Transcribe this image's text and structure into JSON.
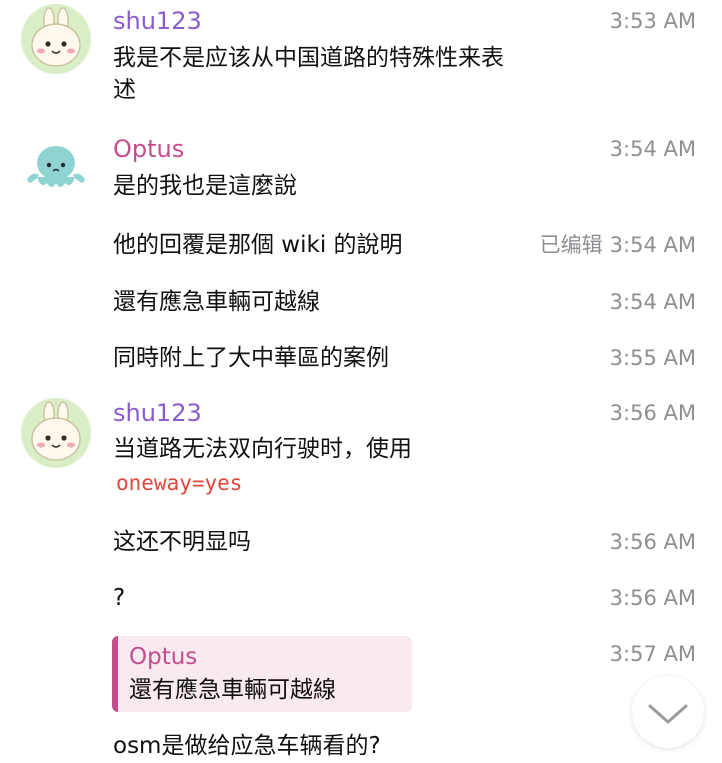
{
  "messages": [
    {
      "sender": "shu123",
      "text_lines": [
        "我是不是应该从中国道路的特殊性来表",
        "述"
      ],
      "time": "3:53 AM"
    },
    {
      "sender": "Optus",
      "text": "是的我也是這麼說",
      "time": "3:54 AM"
    },
    {
      "text": "他的回覆是那個 wiki 的說明",
      "edited": "已编辑",
      "time": "3:54 AM"
    },
    {
      "text": "還有應急車輛可越線",
      "time": "3:54 AM"
    },
    {
      "text": "同時附上了大中華區的案例",
      "time": "3:55 AM"
    },
    {
      "sender": "shu123",
      "text": "当道路无法双向行驶时，使用",
      "code": "oneway=yes",
      "time": "3:56 AM"
    },
    {
      "text": "这还不明显吗",
      "time": "3:56 AM"
    },
    {
      "text": "?",
      "time": "3:56 AM"
    },
    {
      "reply_to": {
        "sender": "Optus",
        "text": "還有應急車輛可越線"
      },
      "time": "3:57 AM",
      "text": "osm是做给应急车辆看的?"
    }
  ],
  "colors": {
    "shu123_name": "#8a5cd0",
    "optus_name": "#c54d8b",
    "code": "#e0463a",
    "time": "#8e8e93",
    "quote_bg": "#f9eaf1"
  },
  "icons": {
    "shu123_avatar": "bunny-avatar-icon",
    "optus_avatar": "octopus-avatar-icon",
    "scroll_down": "chevron-down-icon"
  }
}
